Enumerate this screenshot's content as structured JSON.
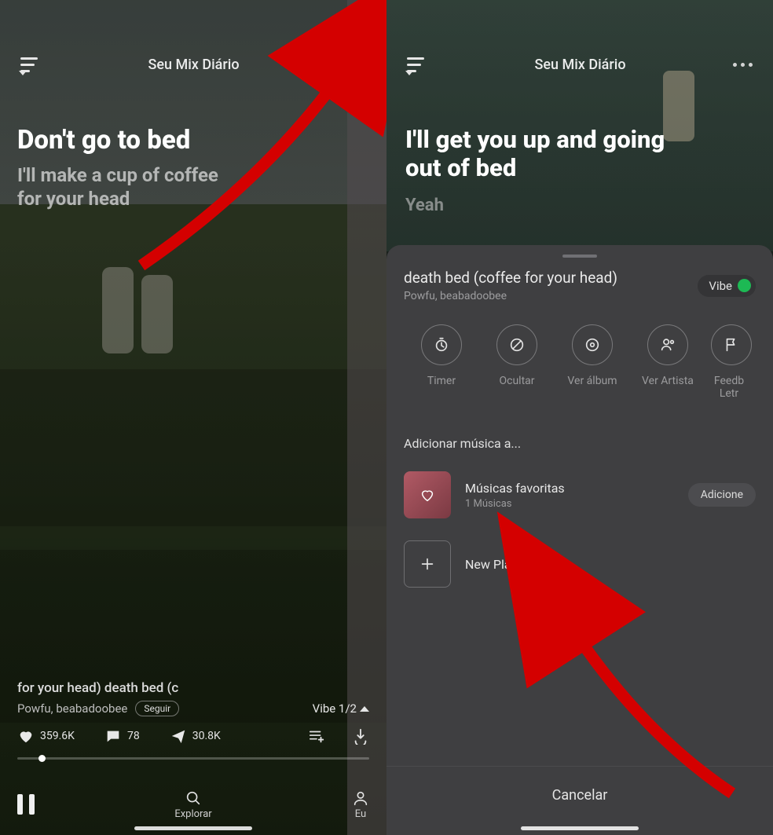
{
  "left": {
    "header": {
      "title": "Seu Mix Diário"
    },
    "lyrics": {
      "current": "Don't go to bed",
      "next_line1": "I'll make a cup of coffee",
      "next_line2": "for your head"
    },
    "song": {
      "title_scroll": "for your head)   death bed (c",
      "artist": "Powfu, beabadoobee",
      "follow_label": "Seguir",
      "vibe_label": "Vibe 1/2"
    },
    "stats": {
      "likes": "359.6K",
      "comments": "78",
      "shares": "30.8K"
    },
    "bottom_nav": {
      "explore": "Explorar",
      "me": "Eu"
    }
  },
  "right": {
    "header": {
      "title": "Seu Mix Diário"
    },
    "lyrics": {
      "current_line1": "I'll get you up and going",
      "current_line2": "out of bed",
      "later": "Yeah"
    },
    "sheet": {
      "title": "death bed (coffee for your head)",
      "artist": "Powfu, beabadoobee",
      "vibe_label": "Vibe",
      "actions": {
        "timer": "Timer",
        "hide": "Ocultar",
        "album": "Ver álbum",
        "artist": "Ver Artista",
        "feedback": "Feedb Letr"
      },
      "add_section_label": "Adicionar música a...",
      "fav_playlist": {
        "name": "Músicas favoritas",
        "count": "1 Músicas",
        "add_label": "Adicione"
      },
      "new_playlist_label": "New Playlist",
      "cancel": "Cancelar"
    }
  },
  "colors": {
    "vibe_green": "#1db954",
    "arrow_red": "#d40000"
  }
}
